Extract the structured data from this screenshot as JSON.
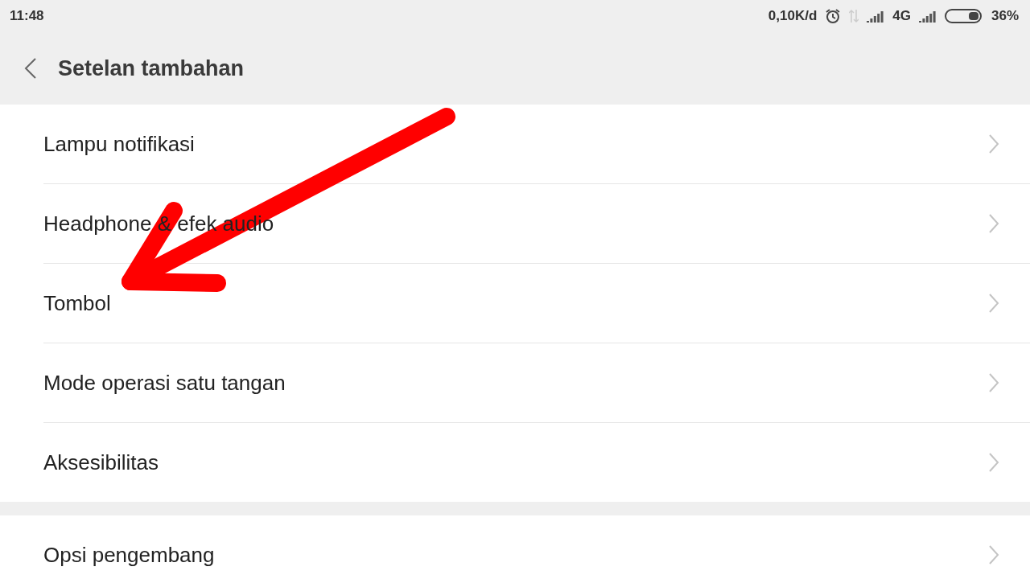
{
  "status_bar": {
    "time": "11:48",
    "speed": "0,10K/d",
    "network": "4G",
    "battery_percent": "36%"
  },
  "header": {
    "title": "Setelan tambahan"
  },
  "sections": [
    {
      "items": [
        {
          "label": "Lampu notifikasi"
        },
        {
          "label": "Headphone & efek audio"
        },
        {
          "label": "Tombol"
        },
        {
          "label": "Mode operasi satu tangan"
        },
        {
          "label": "Aksesibilitas"
        }
      ]
    },
    {
      "items": [
        {
          "label": "Opsi pengembang"
        }
      ]
    }
  ]
}
